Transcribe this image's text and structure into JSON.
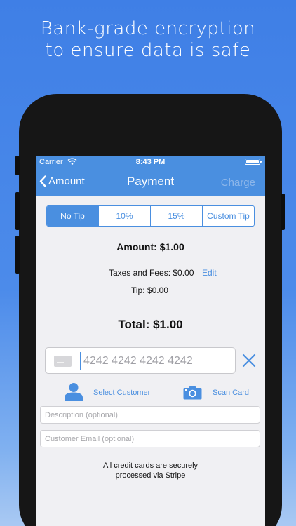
{
  "headline": {
    "line1": "Bank-grade encryption",
    "line2": "to ensure data is safe"
  },
  "status_bar": {
    "carrier": "Carrier",
    "time": "8:43 PM"
  },
  "nav": {
    "back_label": "Amount",
    "title": "Payment",
    "charge_label": "Charge"
  },
  "tip_options": [
    "No Tip",
    "10%",
    "15%",
    "Custom Tip"
  ],
  "tip_selected": "No Tip",
  "summary": {
    "amount": "Amount: $1.00",
    "fees": "Taxes and Fees: $0.00",
    "edit_label": "Edit",
    "tip": "Tip: $0.00",
    "total": "Total: $1.00"
  },
  "card": {
    "placeholder": "4242 4242 4242 4242"
  },
  "actions": {
    "select_customer": "Select Customer",
    "scan_card": "Scan Card"
  },
  "fields": {
    "description_placeholder": "Description (optional)",
    "email_placeholder": "Customer Email (optional)"
  },
  "footer_note": {
    "line1": "All credit cards are securely",
    "line2": "processed via Stripe"
  },
  "colors": {
    "accent": "#4a8fe0",
    "background_top": "#3f7fe6",
    "screen_bg": "#f0f0f3"
  },
  "icons": [
    "wifi-icon",
    "battery-icon",
    "chevron-left-icon",
    "credit-card-icon",
    "close-icon",
    "person-icon",
    "camera-icon"
  ]
}
